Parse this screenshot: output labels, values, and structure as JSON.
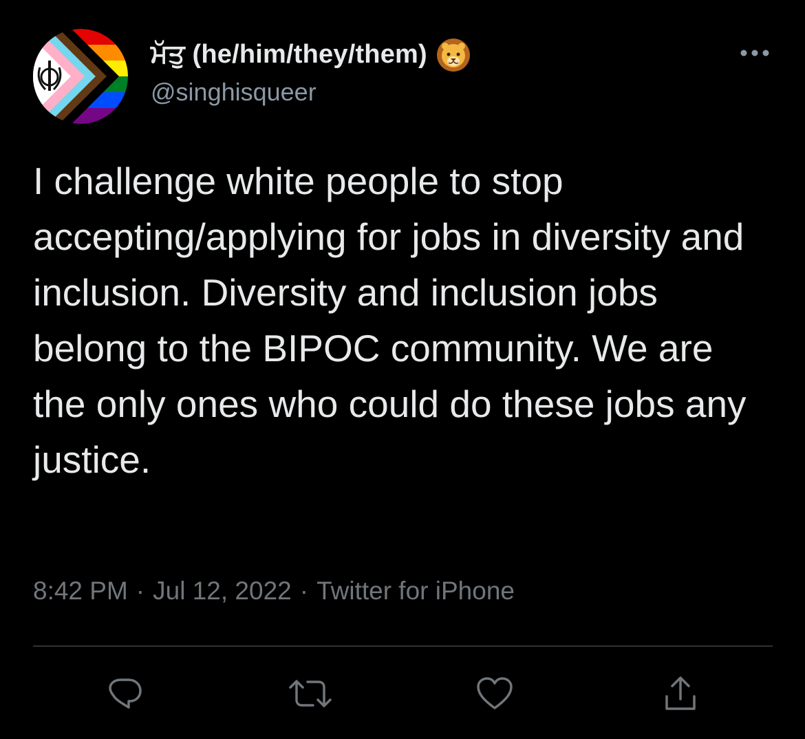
{
  "tweet": {
    "display_name": "ਮੱਤੁ (he/him/they/them)",
    "handle": "@singhisqueer",
    "name_emoji_icon": "lion-face-icon",
    "avatar_icon": "progress-pride-khanda-icon",
    "text": "I challenge white people to stop accepting/applying for jobs in diversity and inclusion. Diversity and inclusion jobs belong to the BIPOC community. We are the only ones who could do these jobs any justice.",
    "time": "8:42 PM",
    "separator": "·",
    "date": "Jul 12, 2022",
    "source": "Twitter for iPhone"
  },
  "actions": [
    {
      "icon": "reply-icon"
    },
    {
      "icon": "retweet-icon"
    },
    {
      "icon": "like-icon"
    },
    {
      "icon": "share-icon"
    }
  ],
  "colors": {
    "background": "#000000",
    "text_primary": "#e7e9ea",
    "text_secondary": "#71767b",
    "divider": "#2f3336"
  }
}
